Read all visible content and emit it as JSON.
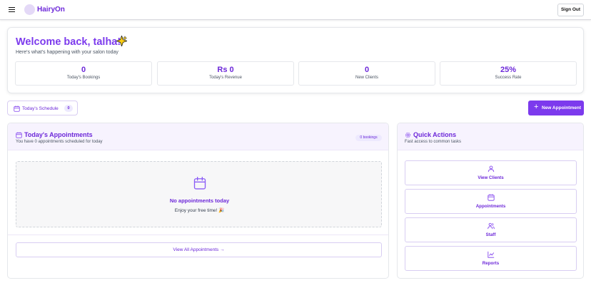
{
  "app": {
    "title": "HairyOn",
    "sign_out_label": "Sign Out"
  },
  "welcome": {
    "title": "Welcome back, talha!",
    "subtitle": "Here's what's happening with your salon today"
  },
  "stats": [
    {
      "value": "0",
      "label": "Today's Bookings"
    },
    {
      "value": "Rs 0",
      "label": "Today's Revenue"
    },
    {
      "value": "0",
      "label": "New Clients"
    },
    {
      "value": "25%",
      "label": "Success Rate"
    }
  ],
  "schedule": {
    "label": "Today's Schedule",
    "count": "0"
  },
  "new_appointment_label": "New Appointment",
  "appointments": {
    "title": "Today's Appointments",
    "subtitle": "You have 0 appointments scheduled for today",
    "badge": "0 bookings",
    "empty_title": "No appointments today",
    "empty_subtitle": "Enjoy your free time! 🎉",
    "view_all_label": "View All Appointments →"
  },
  "quick_actions": {
    "title": "Quick Actions",
    "subtitle": "Fast access to common tasks",
    "items": [
      {
        "label": "View Clients",
        "icon": "user-icon"
      },
      {
        "label": "Appointments",
        "icon": "calendar-icon"
      },
      {
        "label": "Staff",
        "icon": "users-icon"
      },
      {
        "label": "Reports",
        "icon": "chart-icon"
      }
    ]
  },
  "colors": {
    "accent": "#7c3aed",
    "accent_dark": "#6d28d9",
    "accent_light": "#ede9fe",
    "header_tint": "#f7f3fe"
  }
}
